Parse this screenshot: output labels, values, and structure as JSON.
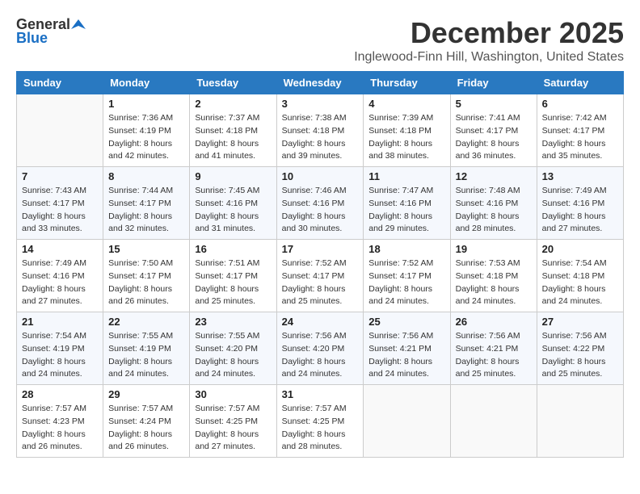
{
  "logo": {
    "general": "General",
    "blue": "Blue"
  },
  "title": "December 2025",
  "location": "Inglewood-Finn Hill, Washington, United States",
  "days_of_week": [
    "Sunday",
    "Monday",
    "Tuesday",
    "Wednesday",
    "Thursday",
    "Friday",
    "Saturday"
  ],
  "weeks": [
    [
      {
        "day": "",
        "sunrise": "",
        "sunset": "",
        "daylight": ""
      },
      {
        "day": "1",
        "sunrise": "7:36 AM",
        "sunset": "4:19 PM",
        "daylight": "8 hours and 42 minutes."
      },
      {
        "day": "2",
        "sunrise": "7:37 AM",
        "sunset": "4:18 PM",
        "daylight": "8 hours and 41 minutes."
      },
      {
        "day": "3",
        "sunrise": "7:38 AM",
        "sunset": "4:18 PM",
        "daylight": "8 hours and 39 minutes."
      },
      {
        "day": "4",
        "sunrise": "7:39 AM",
        "sunset": "4:18 PM",
        "daylight": "8 hours and 38 minutes."
      },
      {
        "day": "5",
        "sunrise": "7:41 AM",
        "sunset": "4:17 PM",
        "daylight": "8 hours and 36 minutes."
      },
      {
        "day": "6",
        "sunrise": "7:42 AM",
        "sunset": "4:17 PM",
        "daylight": "8 hours and 35 minutes."
      }
    ],
    [
      {
        "day": "7",
        "sunrise": "7:43 AM",
        "sunset": "4:17 PM",
        "daylight": "8 hours and 33 minutes."
      },
      {
        "day": "8",
        "sunrise": "7:44 AM",
        "sunset": "4:17 PM",
        "daylight": "8 hours and 32 minutes."
      },
      {
        "day": "9",
        "sunrise": "7:45 AM",
        "sunset": "4:16 PM",
        "daylight": "8 hours and 31 minutes."
      },
      {
        "day": "10",
        "sunrise": "7:46 AM",
        "sunset": "4:16 PM",
        "daylight": "8 hours and 30 minutes."
      },
      {
        "day": "11",
        "sunrise": "7:47 AM",
        "sunset": "4:16 PM",
        "daylight": "8 hours and 29 minutes."
      },
      {
        "day": "12",
        "sunrise": "7:48 AM",
        "sunset": "4:16 PM",
        "daylight": "8 hours and 28 minutes."
      },
      {
        "day": "13",
        "sunrise": "7:49 AM",
        "sunset": "4:16 PM",
        "daylight": "8 hours and 27 minutes."
      }
    ],
    [
      {
        "day": "14",
        "sunrise": "7:49 AM",
        "sunset": "4:16 PM",
        "daylight": "8 hours and 27 minutes."
      },
      {
        "day": "15",
        "sunrise": "7:50 AM",
        "sunset": "4:17 PM",
        "daylight": "8 hours and 26 minutes."
      },
      {
        "day": "16",
        "sunrise": "7:51 AM",
        "sunset": "4:17 PM",
        "daylight": "8 hours and 25 minutes."
      },
      {
        "day": "17",
        "sunrise": "7:52 AM",
        "sunset": "4:17 PM",
        "daylight": "8 hours and 25 minutes."
      },
      {
        "day": "18",
        "sunrise": "7:52 AM",
        "sunset": "4:17 PM",
        "daylight": "8 hours and 24 minutes."
      },
      {
        "day": "19",
        "sunrise": "7:53 AM",
        "sunset": "4:18 PM",
        "daylight": "8 hours and 24 minutes."
      },
      {
        "day": "20",
        "sunrise": "7:54 AM",
        "sunset": "4:18 PM",
        "daylight": "8 hours and 24 minutes."
      }
    ],
    [
      {
        "day": "21",
        "sunrise": "7:54 AM",
        "sunset": "4:19 PM",
        "daylight": "8 hours and 24 minutes."
      },
      {
        "day": "22",
        "sunrise": "7:55 AM",
        "sunset": "4:19 PM",
        "daylight": "8 hours and 24 minutes."
      },
      {
        "day": "23",
        "sunrise": "7:55 AM",
        "sunset": "4:20 PM",
        "daylight": "8 hours and 24 minutes."
      },
      {
        "day": "24",
        "sunrise": "7:56 AM",
        "sunset": "4:20 PM",
        "daylight": "8 hours and 24 minutes."
      },
      {
        "day": "25",
        "sunrise": "7:56 AM",
        "sunset": "4:21 PM",
        "daylight": "8 hours and 24 minutes."
      },
      {
        "day": "26",
        "sunrise": "7:56 AM",
        "sunset": "4:21 PM",
        "daylight": "8 hours and 25 minutes."
      },
      {
        "day": "27",
        "sunrise": "7:56 AM",
        "sunset": "4:22 PM",
        "daylight": "8 hours and 25 minutes."
      }
    ],
    [
      {
        "day": "28",
        "sunrise": "7:57 AM",
        "sunset": "4:23 PM",
        "daylight": "8 hours and 26 minutes."
      },
      {
        "day": "29",
        "sunrise": "7:57 AM",
        "sunset": "4:24 PM",
        "daylight": "8 hours and 26 minutes."
      },
      {
        "day": "30",
        "sunrise": "7:57 AM",
        "sunset": "4:25 PM",
        "daylight": "8 hours and 27 minutes."
      },
      {
        "day": "31",
        "sunrise": "7:57 AM",
        "sunset": "4:25 PM",
        "daylight": "8 hours and 28 minutes."
      },
      {
        "day": "",
        "sunrise": "",
        "sunset": "",
        "daylight": ""
      },
      {
        "day": "",
        "sunrise": "",
        "sunset": "",
        "daylight": ""
      },
      {
        "day": "",
        "sunrise": "",
        "sunset": "",
        "daylight": ""
      }
    ]
  ],
  "labels": {
    "sunrise": "Sunrise:",
    "sunset": "Sunset:",
    "daylight": "Daylight:"
  }
}
